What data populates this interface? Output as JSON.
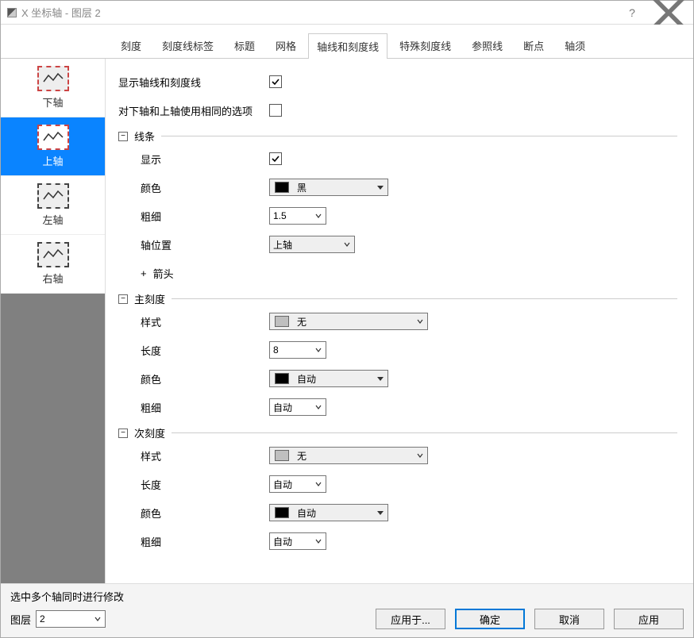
{
  "window": {
    "title": "X 坐标轴 - 图层 2"
  },
  "tabs": [
    "刻度",
    "刻度线标签",
    "标题",
    "网格",
    "轴线和刻度线",
    "特殊刻度线",
    "参照线",
    "断点",
    "轴须"
  ],
  "active_tab": 4,
  "sidebar": {
    "items": [
      {
        "label": "下轴"
      },
      {
        "label": "上轴"
      },
      {
        "label": "左轴"
      },
      {
        "label": "右轴"
      }
    ],
    "selected": 1
  },
  "panel": {
    "show_axis_ticks_label": "显示轴线和刻度线",
    "show_axis_ticks": true,
    "same_top_bottom_label": "对下轴和上轴使用相同的选项",
    "same_top_bottom": false,
    "sections": {
      "line": {
        "title": "线条",
        "show_label": "显示",
        "show": true,
        "color_label": "颜色",
        "color_text": "黑",
        "color_swatch": "#000000",
        "width_label": "粗细",
        "width": "1.5",
        "axis_pos_label": "轴位置",
        "axis_pos": "上轴",
        "arrow_label": "箭头"
      },
      "major": {
        "title": "主刻度",
        "style_label": "样式",
        "style_text": "无",
        "style_swatch": "#bfbfbf",
        "length_label": "长度",
        "length": "8",
        "color_label": "颜色",
        "color_text": "自动",
        "color_swatch": "#000000",
        "width_label": "粗细",
        "width": "自动"
      },
      "minor": {
        "title": "次刻度",
        "style_label": "样式",
        "style_text": "无",
        "style_swatch": "#bfbfbf",
        "length_label": "长度",
        "length": "自动",
        "color_label": "颜色",
        "color_text": "自动",
        "color_swatch": "#000000",
        "width_label": "粗细",
        "width": "自动"
      }
    }
  },
  "footer": {
    "hint": "选中多个轴同时进行修改",
    "layer_label": "图层",
    "layer_value": "2",
    "buttons": {
      "apply_to": "应用于...",
      "ok": "确定",
      "cancel": "取消",
      "apply": "应用"
    }
  }
}
